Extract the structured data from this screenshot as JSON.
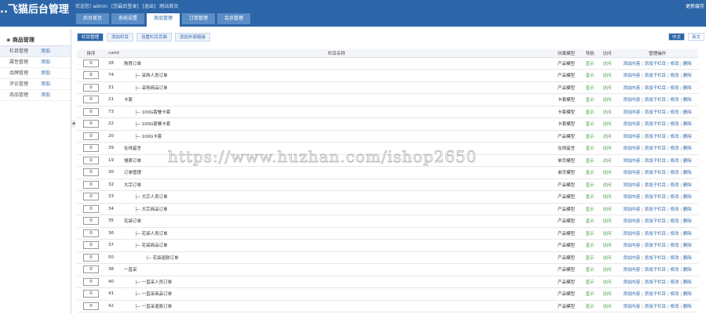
{
  "header": {
    "logo": "..飞猫后台管理",
    "user": [
      "欢迎您! admin",
      "[您最后登录]",
      "[退出]",
      "网站首页"
    ],
    "right_text": "更新缓存"
  },
  "main_tabs": [
    "后台首页",
    "系统设置",
    "商品管理",
    "订单管理",
    "会员管理"
  ],
  "sidebar": {
    "title": "商品管理",
    "items": [
      {
        "label": "栏目管理",
        "add": "添加"
      },
      {
        "label": "属性管理",
        "add": "添加"
      },
      {
        "label": "品牌管理",
        "add": "添加"
      },
      {
        "label": "评论管理",
        "add": "添加"
      },
      {
        "label": "商品管理",
        "add": "添加"
      }
    ]
  },
  "subtabs": [
    "栏目管理",
    "添加栏目",
    "设置栏目页面",
    "添加外部链接"
  ],
  "lang": [
    "中文",
    "英文"
  ],
  "columns": [
    "排序",
    "catid",
    "栏目名称",
    "所属模型",
    "导航",
    "访问",
    "管理操作"
  ],
  "ops": [
    "添加内容",
    "添加子栏目",
    "修改",
    "删除"
  ],
  "rows": [
    {
      "sort": "0",
      "id": "28",
      "name": "购買订单",
      "level": 0,
      "model": "产品模型",
      "nav": "显示",
      "access": "访问"
    },
    {
      "sort": "0",
      "id": "74",
      "name": "采购人员订单",
      "level": 1,
      "model": "产品模型",
      "nav": "显示",
      "access": "访问"
    },
    {
      "sort": "0",
      "id": "31",
      "name": "采购商品订单",
      "level": 1,
      "model": "产品模型",
      "nav": "显示",
      "access": "访问"
    },
    {
      "sort": "0",
      "id": "21",
      "name": "卡套",
      "level": 0,
      "model": "卡套模型",
      "nav": "显示",
      "access": "访问"
    },
    {
      "sort": "0",
      "id": "73",
      "name": "100G套餐卡套",
      "level": 1,
      "model": "卡套模型",
      "nav": "显示",
      "access": "访问"
    },
    {
      "sort": "0",
      "id": "22",
      "name": "100G套餐卡套",
      "level": 1,
      "model": "卡套模型",
      "nav": "显示",
      "access": "访问"
    },
    {
      "sort": "0",
      "id": "20",
      "name": "100G卡套",
      "level": 1,
      "model": "产品模型",
      "nav": "显示",
      "access": "访问"
    },
    {
      "sort": "0",
      "id": "39",
      "name": "在线留言",
      "level": 0,
      "model": "在线留言",
      "nav": "显示",
      "access": "访问"
    },
    {
      "sort": "0",
      "id": "19",
      "name": "搜索订单",
      "level": 0,
      "model": "单页模型",
      "nav": "显示",
      "access": "访问"
    },
    {
      "sort": "0",
      "id": "30",
      "name": "订单管理",
      "level": 0,
      "model": "单页模型",
      "nav": "显示",
      "access": "访问"
    },
    {
      "sort": "0",
      "id": "32",
      "name": "大宗订单",
      "level": 0,
      "model": "产品模型",
      "nav": "显示",
      "access": "访问"
    },
    {
      "sort": "0",
      "id": "33",
      "name": "大宗人员订单",
      "level": 1,
      "model": "产品模型",
      "nav": "显示",
      "access": "访问"
    },
    {
      "sort": "0",
      "id": "34",
      "name": "大宗商品订单",
      "level": 1,
      "model": "产品模型",
      "nav": "显示",
      "access": "访问"
    },
    {
      "sort": "0",
      "id": "35",
      "name": "花袋订单",
      "level": 0,
      "model": "产品模型",
      "nav": "显示",
      "access": "访问"
    },
    {
      "sort": "0",
      "id": "36",
      "name": "花袋人员订单",
      "level": 1,
      "model": "产品模型",
      "nav": "显示",
      "access": "访问"
    },
    {
      "sort": "0",
      "id": "37",
      "name": "花袋商品订单",
      "level": 1,
      "model": "产品模型",
      "nav": "显示",
      "access": "访问"
    },
    {
      "sort": "0",
      "id": "50",
      "name": "花袋退款订单",
      "level": 2,
      "model": "产品模型",
      "nav": "显示",
      "access": "访问"
    },
    {
      "sort": "0",
      "id": "38",
      "name": "一直采",
      "level": 0,
      "model": "产品模型",
      "nav": "显示",
      "access": "访问"
    },
    {
      "sort": "0",
      "id": "40",
      "name": "一直采人员订单",
      "level": 1,
      "model": "产品模型",
      "nav": "显示",
      "access": "访问"
    },
    {
      "sort": "0",
      "id": "41",
      "name": "一直采商品订单",
      "level": 1,
      "model": "产品模型",
      "nav": "显示",
      "access": "访问"
    },
    {
      "sort": "0",
      "id": "42",
      "name": "一直采退款订单",
      "level": 1,
      "model": "产品模型",
      "nav": "显示",
      "access": "访问"
    }
  ],
  "watermark": "https://www.huzhan.com/ishop2650",
  "colors": {
    "header": "#2d66a8",
    "green": "#3a9a3a"
  }
}
